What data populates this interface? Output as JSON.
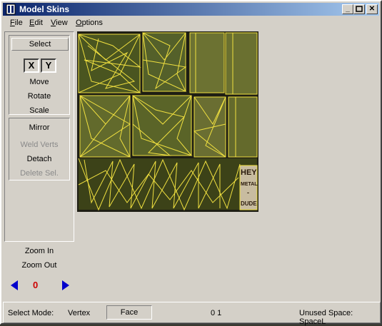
{
  "window": {
    "title": "Model Skins"
  },
  "menu": {
    "file": "ile",
    "file_key": "F",
    "edit": "dit",
    "edit_key": "E",
    "view": "iew",
    "view_key": "V",
    "options": "ptions",
    "options_key": "O"
  },
  "tools": {
    "select": "Select",
    "x": "X",
    "y": "Y",
    "move": "Move",
    "rotate": "Rotate",
    "scale": "Scale",
    "mirror": "Mirror",
    "weld": "Weld Verts",
    "detach": "Detach",
    "delete": "Delete Sel."
  },
  "zoom": {
    "in": "Zoom In",
    "out": "Zoom Out",
    "value": "0"
  },
  "status": {
    "mode_label": "Select Mode:",
    "vertex": "Vertex",
    "face": "Face",
    "coords": "0 1",
    "unused": "Unused Space: SpaceL"
  },
  "colors": {
    "wire": "#f0e040",
    "olive": "#5c6a2a",
    "dark": "#1e1e14"
  },
  "skin_text": {
    "hey": "HEY",
    "metal": "METAL",
    "dash": "-",
    "dude": "DUDE"
  }
}
